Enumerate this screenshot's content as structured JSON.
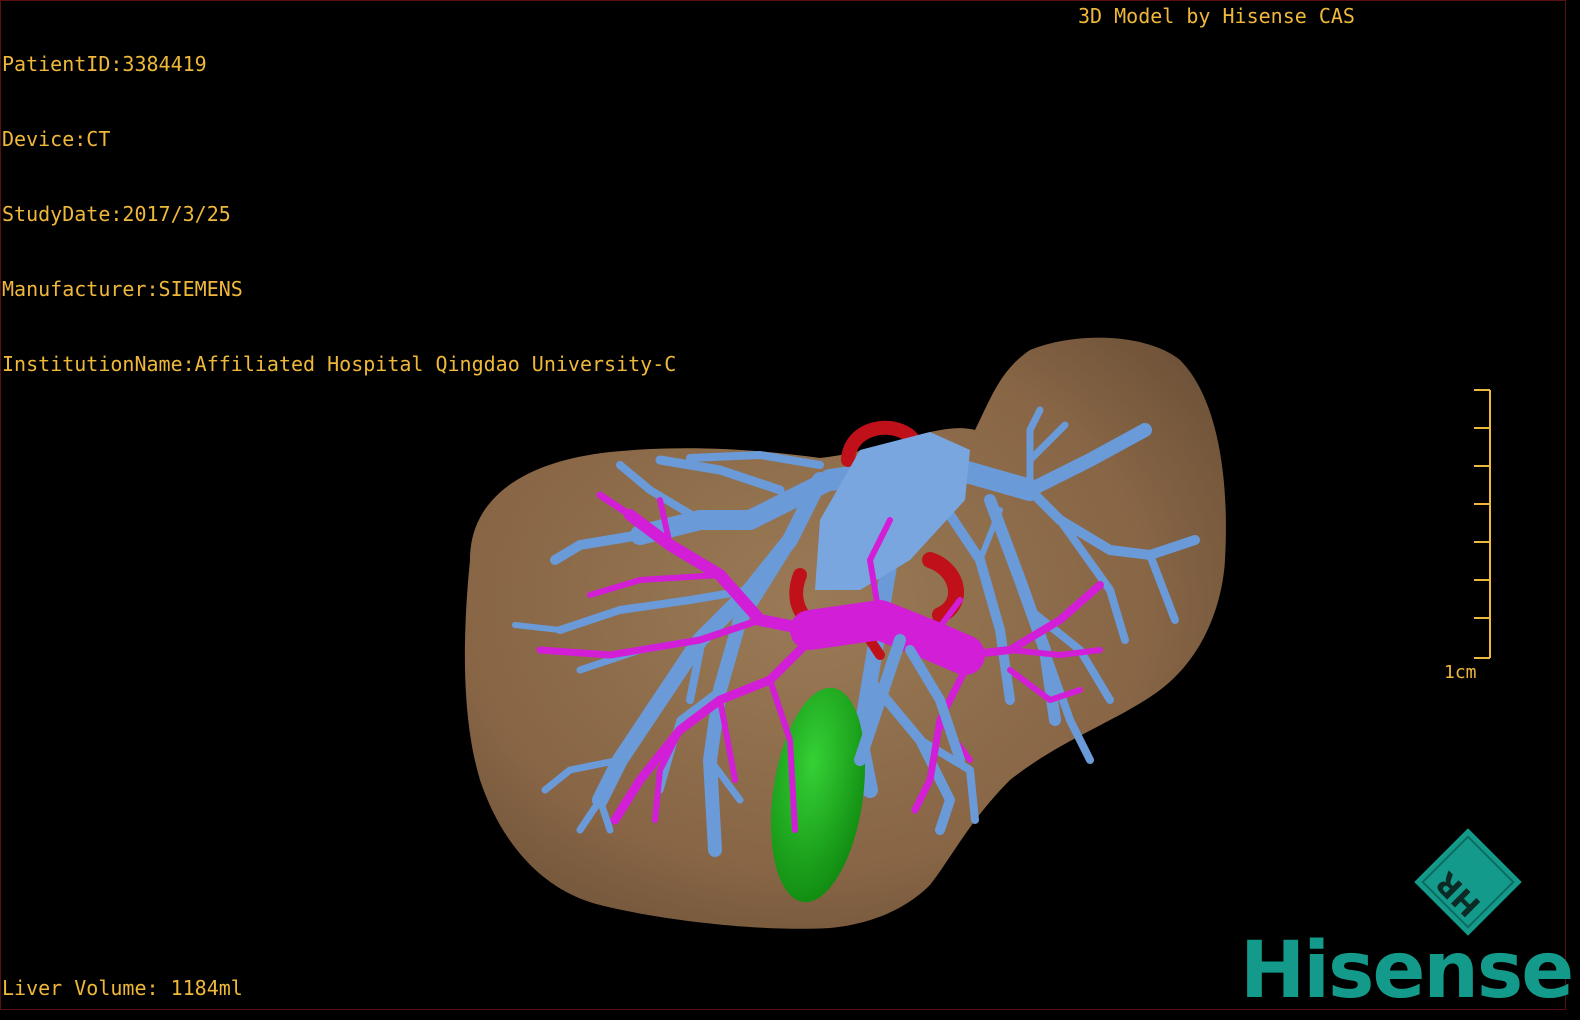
{
  "viewer": {
    "patient_id": "PatientID:3384419",
    "device": "Device:CT",
    "study_date": "StudyDate:2017/3/25",
    "manufacturer": "Manufacturer:SIEMENS",
    "institution": "InstitutionName:Affiliated Hospital Qingdao University-C",
    "brand_title": "3D Model by Hisense CAS",
    "liver_volume": "Liver Volume: 1184ml",
    "scale_label": "1cm"
  },
  "logo": {
    "word": "Hisense",
    "mark_letters": "HR"
  },
  "colors": {
    "text": "#f0b83a",
    "liver": "#8a6a48",
    "hepatic_vein": "#6a9ad8",
    "portal_vein": "#d21ed6",
    "artery": "#c0101a",
    "gallbladder": "#1fae1f",
    "logo": "#149a8a"
  }
}
